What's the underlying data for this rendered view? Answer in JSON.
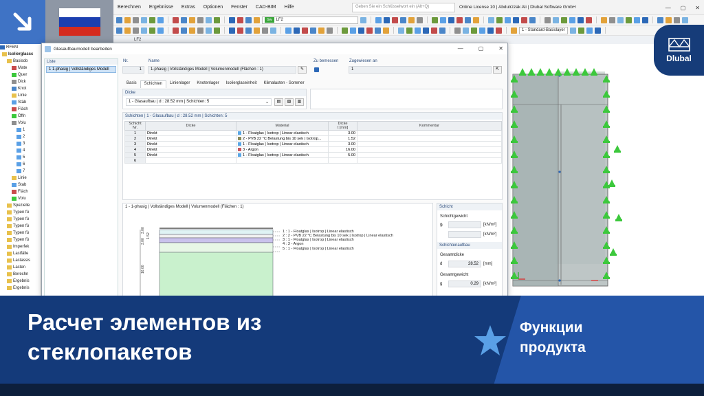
{
  "menu": [
    "Berechnen",
    "Ergebnisse",
    "Extras",
    "Optionen",
    "Fenster",
    "CAD-BIM",
    "Hilfe"
  ],
  "search_placeholder": "Geben Sie ein Schlüsselwort ein (Alt+Q)",
  "license_text": "Online License 10 | Abdulrzzak Ali | Dlubal Software GmbH",
  "toolbar": {
    "load_tag": "Gw",
    "load_case": "LF2",
    "layer_combo": "1 - Standard-Basislayer"
  },
  "lcbar_label": "LF2",
  "navigator": {
    "title": "RFEM",
    "items": [
      "Isolierglassc",
      "Basisob",
      "Mate",
      "Quer",
      "Dick",
      "Knot",
      "Linie",
      "Stäb",
      "Fläch",
      "Öffn",
      "Volu",
      "1",
      "2",
      "3",
      "4",
      "5",
      "6",
      "7",
      "Linie",
      "Stab",
      "Fläch",
      "Volu",
      "Spezielle",
      "Typen fü",
      "Typen fü",
      "Typen fü",
      "Typen fü",
      "Typen fü",
      "Imperfek",
      "Lastfälle",
      "Lastassis",
      "Lasten",
      "Berechn",
      "Ergebnis",
      "Ergebnis"
    ]
  },
  "dialog": {
    "title": "Glasaufbaumodell bearbeiten",
    "list_label": "Liste",
    "list_item": "1  1-phasig | Vollständiges Modell",
    "nr_label": "Nr.",
    "nr_value": "1",
    "name_label": "Name",
    "name_value": "1-phasig | Vollständiges Modell | Volumenmodell (Flächen : 1)",
    "to_design_label": "Zu bemessen",
    "assigned_label": "Zugewiesen an",
    "assigned_value": "1",
    "tabs": [
      "Basis",
      "Schichten",
      "Linienlager",
      "Knotenlager",
      "Isolierglaseinheit",
      "Klimalasten - Sommer"
    ],
    "thickness_label": "Dicke",
    "thickness_value": "1 - Glasaufbau | d : 28.52 mm | Schichten: 5",
    "layers_title": "Schichten | 1 - Glasaufbau | d : 28.52 mm | Schichten: 5",
    "columns": {
      "layer": "Schicht",
      "nr": "Nr.",
      "thickness_type": "Dicke",
      "material": "Material",
      "thickness": "Dicke",
      "thickness_unit": "t [mm]",
      "comment": "Kommentar"
    },
    "rows": [
      {
        "nr": "1",
        "type": "Direkt",
        "material": "1 - Floatglas | Isotrop | Linear elastisch",
        "color": "#5aa7e6",
        "t": "3.00"
      },
      {
        "nr": "2",
        "type": "Direkt",
        "material": "2 - PVB 22 °C Belastung bis 10 sek | Isotrop...",
        "color": "#8b8b5a",
        "t": "1.52"
      },
      {
        "nr": "3",
        "type": "Direkt",
        "material": "1 - Floatglas | Isotrop | Linear elastisch",
        "color": "#5aa7e6",
        "t": "3.00"
      },
      {
        "nr": "4",
        "type": "Direkt",
        "material": "3 - Argon",
        "color": "#c8575f",
        "t": "16.00"
      },
      {
        "nr": "5",
        "type": "Direkt",
        "material": "1 - Floatglas | Isotrop | Linear elastisch",
        "color": "#5aa7e6",
        "t": "5.00"
      },
      {
        "nr": "6",
        "type": "",
        "material": "",
        "color": "",
        "t": ""
      }
    ],
    "preview_title": "1 - 1-phasig | Vollständiges Modell | Volumenmodell (Flächen : 1)",
    "preview_labels": [
      "1 :  1 - Floatglas | Isotrop | Linear elastisch",
      "2 :  2 - PVB 22 °C Belastung bis 10 sek | Isotrop | Linear elastisch",
      "3 :  1 - Floatglas | Isotrop | Linear elastisch",
      "4 :  3 - Argon",
      "5 :  1 - Floatglas | Isotrop | Linear elastisch"
    ],
    "dim_labels": [
      "3.00",
      "1.52",
      "3.00",
      "16.00"
    ],
    "side": {
      "layer_head": "Schicht",
      "layer_weight": "Schichtgewicht",
      "gi": "gᵢ",
      "unit_knm2": "[kN/m²]",
      "build_head": "Schichtenaufbau",
      "total_thickness": "Gesamtdicke",
      "d": "d",
      "d_value": "28.52",
      "unit_mm": "[mm]",
      "total_weight": "Gesamtgewicht",
      "g": "g",
      "g_value": "0.29"
    }
  },
  "logo_text": "Dlubal",
  "banner": {
    "headline_line1": "Расчет элементов из",
    "headline_line2": "стеклопакетов",
    "features_line1": "Функции",
    "features_line2": "продукта"
  },
  "colors": {
    "banner": "#143a7a",
    "banner_accent": "#2455a8",
    "logo": "#163c79",
    "badge_blue": "#3f73c5",
    "support_green": "#3cc83c"
  }
}
